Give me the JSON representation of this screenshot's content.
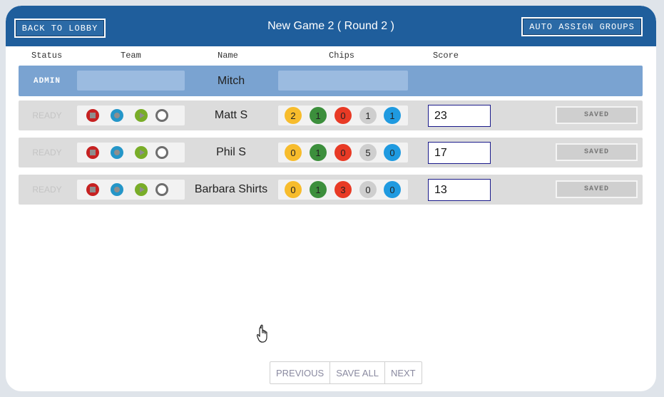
{
  "header": {
    "back_label": "BACK TO LOBBY",
    "title": "New Game 2 ( Round 2 )",
    "auto_label": "AUTO ASSIGN GROUPS"
  },
  "columns": {
    "status": "Status",
    "team": "Team",
    "name": "Name",
    "chips": "Chips",
    "score": "Score"
  },
  "admin_row": {
    "status": "ADMIN",
    "name": "Mitch"
  },
  "players": [
    {
      "status": "READY",
      "name": "Matt S",
      "chips": [
        "2",
        "1",
        "0",
        "1",
        "1"
      ],
      "score": "23",
      "saved": "SAVED"
    },
    {
      "status": "READY",
      "name": "Phil S",
      "chips": [
        "0",
        "1",
        "0",
        "5",
        "0"
      ],
      "score": "17",
      "saved": "SAVED"
    },
    {
      "status": "READY",
      "name": "Barbara Shirts",
      "chips": [
        "0",
        "1",
        "3",
        "0",
        "0"
      ],
      "score": "13",
      "saved": "SAVED"
    }
  ],
  "pager": {
    "previous": "PREVIOUS",
    "save_all": "SAVE ALL",
    "next": "NEXT"
  },
  "team_icons": [
    "stop-icon",
    "record-icon",
    "play-icon",
    "ring-icon"
  ],
  "colors": {
    "header": "#1f5e9c",
    "admin_row": "#7aa3d1",
    "chip_yellow": "#f7bc2c",
    "chip_green": "#3c8f3c",
    "chip_red": "#e83a25",
    "chip_grey": "#cecece",
    "chip_blue": "#1f9ae0"
  }
}
